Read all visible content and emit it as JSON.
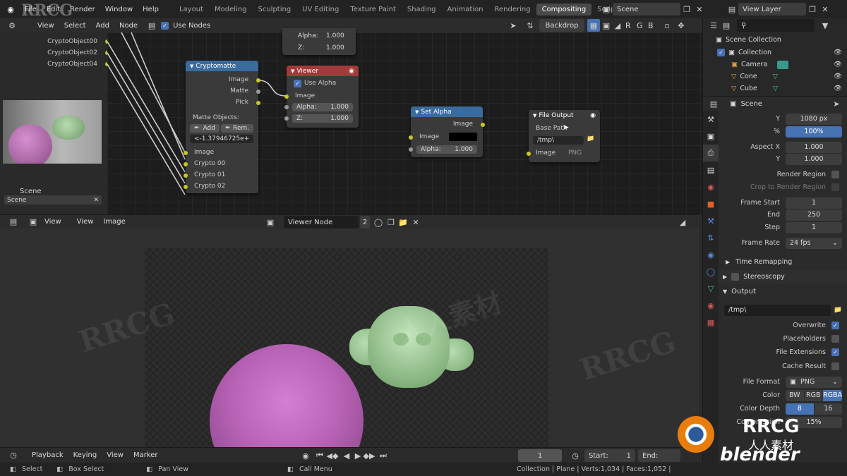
{
  "topbar": {
    "menus": [
      "File",
      "Edit",
      "Render",
      "Window",
      "Help"
    ],
    "workspaces": [
      "Layout",
      "Modeling",
      "Sculpting",
      "UV Editing",
      "Texture Paint",
      "Shading",
      "Animation",
      "Rendering",
      "Compositing",
      "Scripting"
    ],
    "active_workspace": "Compositing",
    "scene": "Scene",
    "view_layer": "View Layer"
  },
  "node_editor": {
    "menus": [
      "View",
      "Select",
      "Add",
      "Node"
    ],
    "use_nodes_label": "Use Nodes",
    "backdrop_label": "Backdrop",
    "channels": [
      "R",
      "G",
      "B"
    ],
    "left_sockets": [
      "CryptoObject00",
      "CryptoObject02",
      "CryptoObject04"
    ],
    "top_node": {
      "alpha_label": "Alpha:",
      "alpha_value": "1.000",
      "z_label": "Z:",
      "z_value": "1.000"
    },
    "cryptomatte": {
      "title": "Cryptomatte",
      "outputs": [
        "Image",
        "Matte",
        "Pick"
      ],
      "matte_objects_label": "Matte Objects:",
      "add_label": "Add",
      "remove_label": "Rem.",
      "matte_value": "<-1.37946725e+...",
      "inputs": [
        "Image",
        "Crypto 00",
        "Crypto 01",
        "Crypto 02"
      ]
    },
    "viewer": {
      "title": "Viewer",
      "use_alpha_label": "Use Alpha",
      "image_label": "Image",
      "alpha_label": "Alpha:",
      "alpha_value": "1.000",
      "z_label": "Z:",
      "z_value": "1.000"
    },
    "set_alpha": {
      "title": "Set Alpha",
      "output": "Image",
      "image_label": "Image",
      "alpha_label": "Alpha:",
      "alpha_value": "1.000"
    },
    "file_output": {
      "title": "File Output",
      "base_path_label": "Base Path",
      "path_value": "/tmp\\",
      "image_label": "Image",
      "format": "PNG"
    },
    "preview_label": "Scene",
    "preview_field": "Scene"
  },
  "image_editor": {
    "menus": [
      "View",
      "View",
      "Image"
    ],
    "image_name": "Viewer Node",
    "users": "2"
  },
  "timeline": {
    "menus": [
      "Playback",
      "Keying",
      "View",
      "Marker"
    ],
    "current_frame": "1",
    "start_label": "Start:",
    "start_value": "1",
    "end_label": "End:"
  },
  "statusbar": {
    "items": [
      "Select",
      "Box Select",
      "Pan View",
      "Call Menu"
    ],
    "stats": "Collection | Plane | Verts:1,034 | Faces:1,052 |"
  },
  "outliner": {
    "root": "Scene Collection",
    "collection": "Collection",
    "items": [
      "Camera",
      "Cone",
      "Cube"
    ]
  },
  "properties": {
    "context": "Scene",
    "resolution_y_label": "Y",
    "resolution_y": "1080 px",
    "percent_label": "%",
    "percent": "100%",
    "aspect_x_label": "Aspect X",
    "aspect_x": "1.000",
    "aspect_y_label": "Y",
    "aspect_y": "1.000",
    "render_region_label": "Render Region",
    "crop_label": "Crop to Render Region",
    "frame_start_label": "Frame Start",
    "frame_start": "1",
    "end_label": "End",
    "end": "250",
    "step_label": "Step",
    "step": "1",
    "frame_rate_label": "Frame Rate",
    "frame_rate": "24 fps",
    "time_remapping_label": "Time Remapping",
    "stereoscopy_label": "Stereoscopy",
    "output_label": "Output",
    "output_path": "/tmp\\",
    "overwrite_label": "Overwrite",
    "placeholders_label": "Placeholders",
    "file_extensions_label": "File Extensions",
    "cache_result_label": "Cache Result",
    "file_format_label": "File Format",
    "file_format": "PNG",
    "color_label": "Color",
    "color_options": [
      "BW",
      "RGB",
      "RGBA"
    ],
    "color_depth_label": "Color Depth",
    "color_depth_options": [
      "8",
      "16"
    ],
    "compression_label": "Compression",
    "compression": "15%"
  },
  "watermark": {
    "text": "RRCG",
    "cn": "人人素材",
    "brand": "blender"
  },
  "colors": {
    "accent": "#4772b3",
    "cryptomatte_header": "#3a6b9e",
    "viewer_header": "#a33a3a",
    "set_alpha_header": "#3a6b9e",
    "socket_yellow": "#c7c729"
  }
}
